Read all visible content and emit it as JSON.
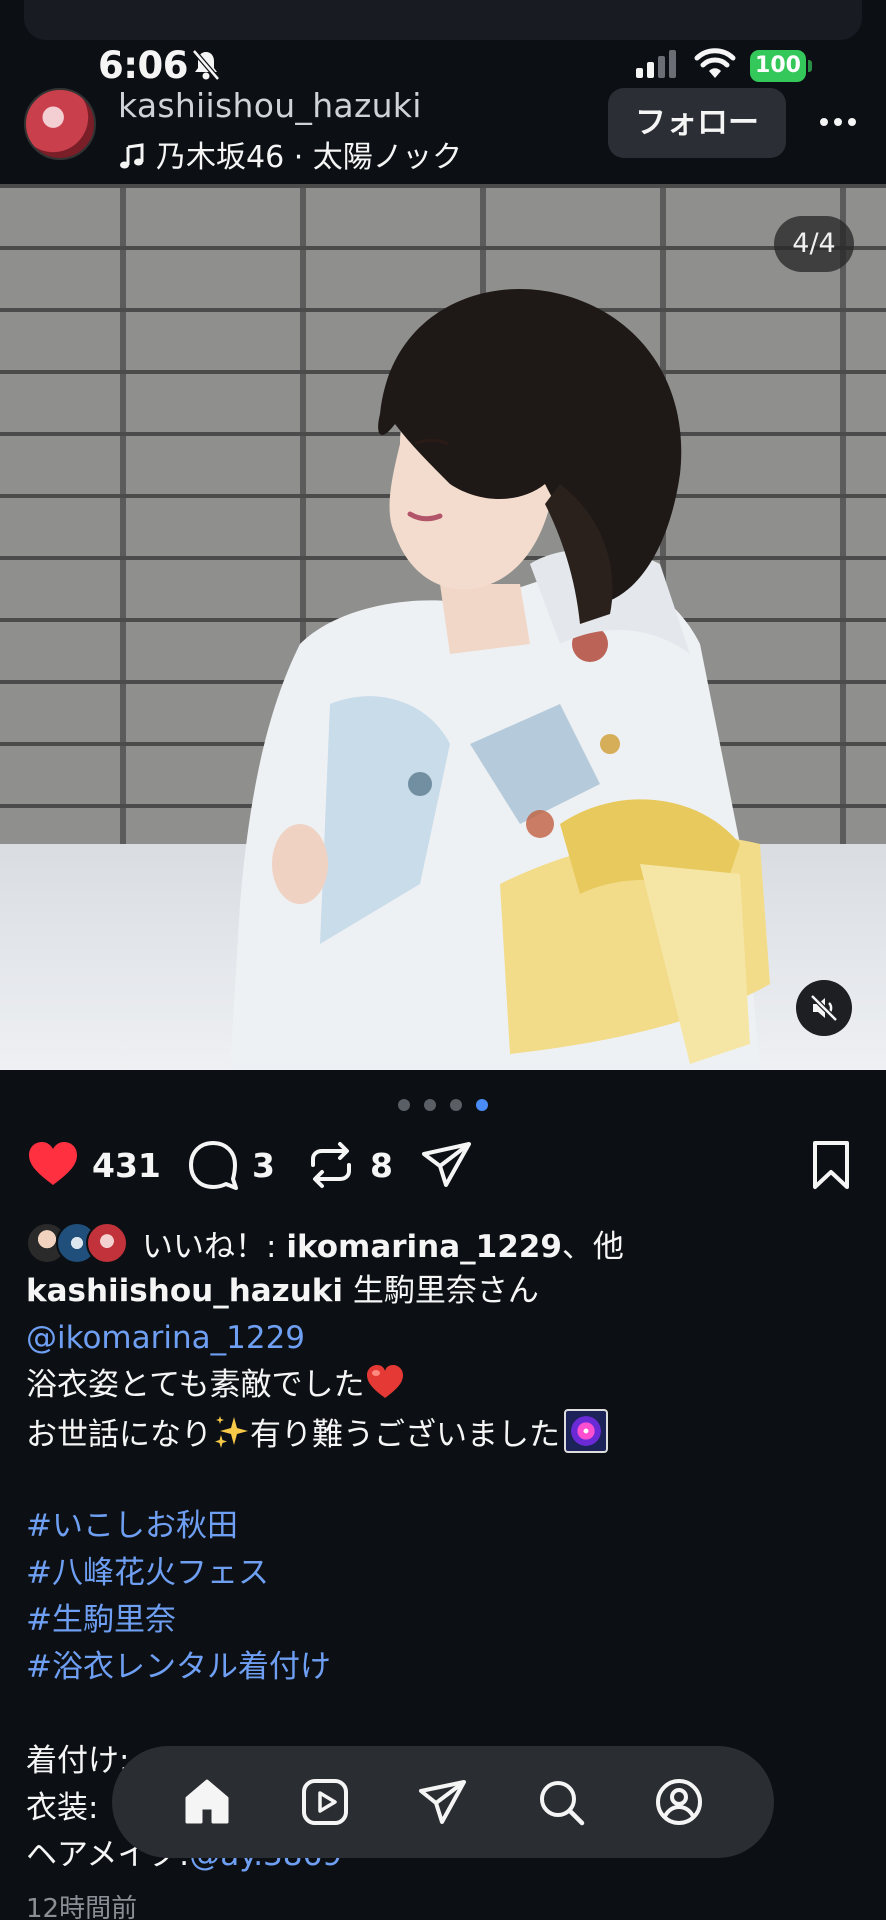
{
  "status_bar": {
    "time": "6:06",
    "battery": "100",
    "icons": [
      "bell-slash-icon",
      "cellular-signal-icon",
      "wifi-icon",
      "battery-icon"
    ]
  },
  "post": {
    "username": "kashiishou_hazuki",
    "music": "乃木坂46 · 太陽ノック",
    "follow_label": "フォロー",
    "media_counter": "4/4",
    "carousel": {
      "total": 4,
      "active_index": 3
    }
  },
  "actions": {
    "likes": "431",
    "comments": "3",
    "reposts": "8"
  },
  "liked_by": {
    "prefix": "いいね！: ",
    "user": "ikomarina_1229",
    "suffix": "、他"
  },
  "caption": {
    "author": "kashiishou_hazuki",
    "line1": " 生駒里奈さん",
    "mention1": "@ikomarina_1229",
    "line3": "浴衣姿とても素敵でした",
    "line4a": "お世話になり",
    "line4b": "有り難うございました",
    "hashtags": [
      "#いこしお秋田",
      "#八峰花火フェス",
      "#生駒里奈",
      "#浴衣レンタル着付け"
    ],
    "credit1": "着付け:",
    "credit2": "衣装:",
    "credit3_label": "ヘアメイク:",
    "credit3_mention": "@ay.3869"
  },
  "timestamp": "12時間前",
  "colors": {
    "background": "#0c1014",
    "like_red": "#ff3040",
    "link_blue": "#6f9ff3",
    "battery_green": "#34c759"
  }
}
